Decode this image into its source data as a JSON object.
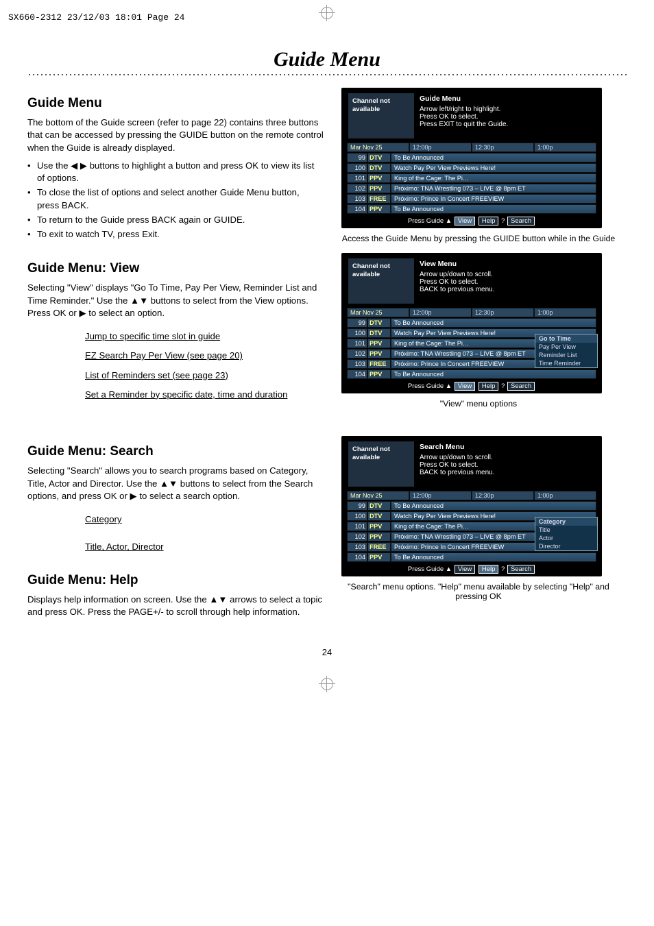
{
  "slug": "SX660-2312  23/12/03  18:01  Page 24",
  "page_title": "Guide Menu",
  "page_number": "24",
  "sections": {
    "guide_menu": {
      "heading": "Guide Menu",
      "para": "The bottom of the Guide screen (refer to page 22) contains three buttons that can be accessed by pressing the GUIDE button on the remote control when the Guide is already displayed.",
      "bullets": [
        "Use the ◀ ▶ buttons to highlight a button and press OK to view its list of options.",
        "To close the list of options and select another Guide Menu button, press BACK.",
        "To return to the Guide press BACK again or GUIDE.",
        "To exit to watch TV, press Exit."
      ]
    },
    "view": {
      "heading": "Guide Menu: View",
      "para": "Selecting \"View\" displays \"Go To Time, Pay Per View, Reminder List and Time Reminder.\" Use the ▲▼ buttons to select from the View options. Press OK or ▶ to select an option.",
      "links": [
        "Jump to specific time slot in guide",
        "EZ Search Pay Per View (see page 20)",
        "List of Reminders set (see page 23)",
        "Set a Reminder by specific date, time and duration"
      ]
    },
    "search": {
      "heading": "Guide Menu: Search",
      "para": "Selecting \"Search\" allows you to search programs based on Category, Title, Actor and Director. Use the ▲▼ buttons to select from the Search options, and press OK or ▶ to select a search option.",
      "links": [
        "Category",
        "Title, Actor, Director"
      ]
    },
    "help": {
      "heading": "Guide Menu: Help",
      "para": "Displays help information on screen. Use the ▲▼ arrows to select a topic and press OK. Press the PAGE+/- to scroll through help information."
    }
  },
  "captions": {
    "fig1": "Access the Guide Menu by pressing the GUIDE button while in the Guide",
    "fig2": "\"View\" menu options",
    "fig3": "\"Search\" menu options. \"Help\" menu available by selecting \"Help\" and pressing OK"
  },
  "tv_common": {
    "channel_not_available": "Channel not available",
    "date": "Mar Nov 25",
    "times": [
      "12:00p",
      "12:30p",
      "1:00p"
    ],
    "rows": [
      {
        "ch": "99",
        "tag": "DTV",
        "prg": "To Be Announced"
      },
      {
        "ch": "100",
        "tag": "DTV",
        "prg": "Watch Pay Per View Previews Here!"
      },
      {
        "ch": "101",
        "tag": "PPV",
        "prg": "King of the Cage: The Pi…"
      },
      {
        "ch": "102",
        "tag": "PPV",
        "prg": "Próximo: TNA Wrestling 073 – LIVE @ 8pm ET"
      },
      {
        "ch": "103",
        "tag": "FREE",
        "prg": "Próximo: Prince In Concert FREEVIEW"
      },
      {
        "ch": "104",
        "tag": "PPV",
        "prg": "To Be Announced"
      }
    ],
    "footer_prefix": "Press Guide ▲",
    "footer_buttons": [
      "View",
      "Help",
      "Search"
    ]
  },
  "tv1": {
    "title": "Guide Menu",
    "instr": [
      "Arrow left/right to highlight.",
      "Press OK to select.",
      "Press EXIT to quit the Guide."
    ]
  },
  "tv2": {
    "title": "View Menu",
    "instr": [
      "Arrow up/down to scroll.",
      "Press OK to select.",
      "BACK to previous menu."
    ],
    "popup": [
      "Go to Time",
      "Pay Per View",
      "Reminder List",
      "Time Reminder"
    ]
  },
  "tv3": {
    "title": "Search Menu",
    "instr": [
      "Arrow up/down to scroll.",
      "Press OK to select.",
      "BACK to previous menu."
    ],
    "popup": [
      "Category",
      "Title",
      "Actor",
      "Director"
    ]
  }
}
